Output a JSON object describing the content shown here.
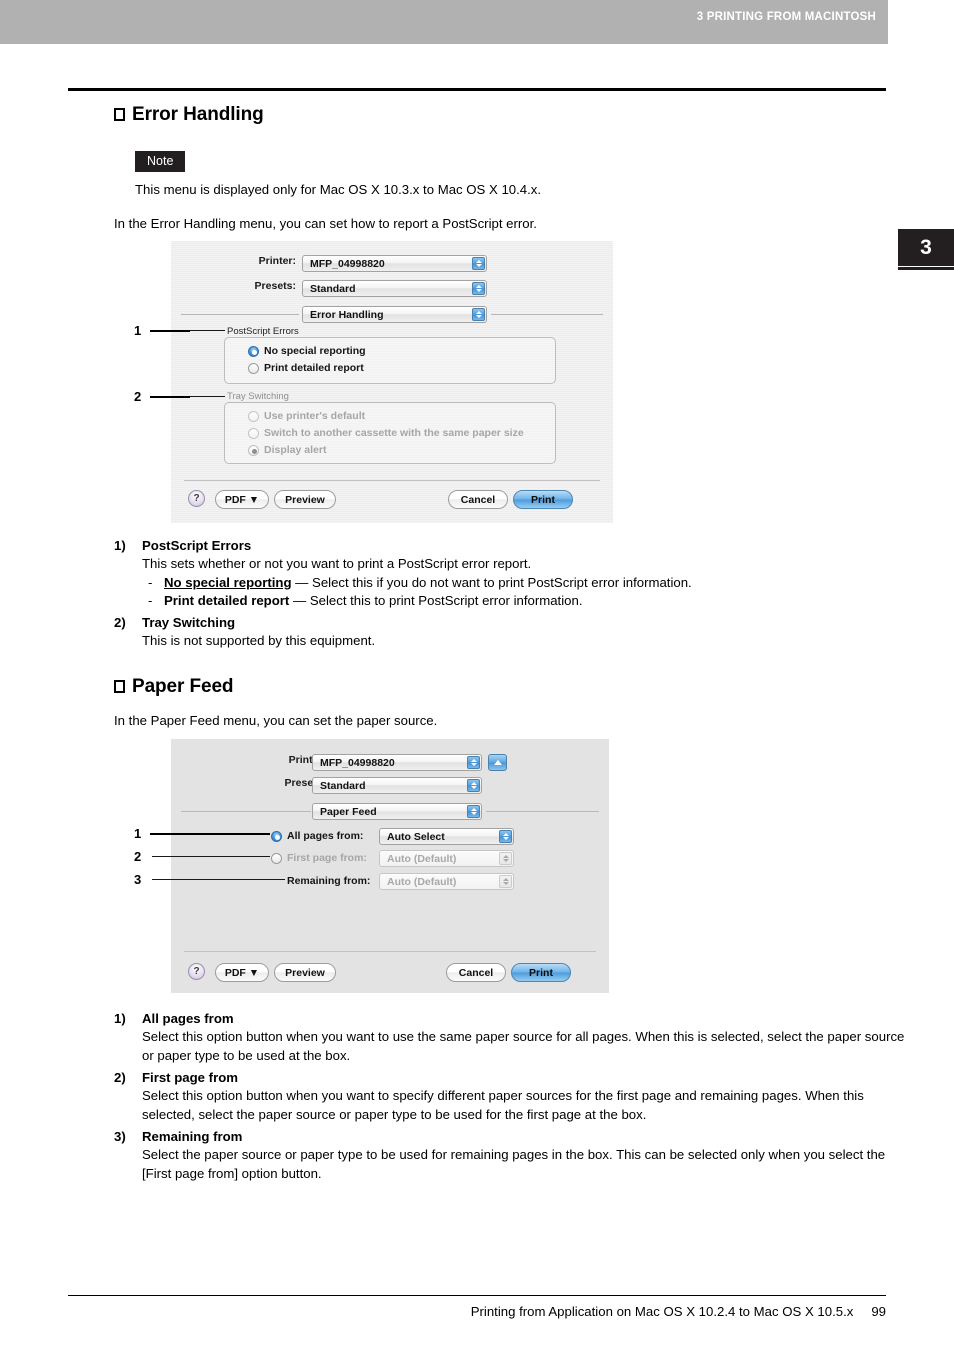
{
  "header": {
    "running_title": "3 PRINTING FROM MACINTOSH"
  },
  "chapter_tab": {
    "number": "3"
  },
  "sections": {
    "error_handling": {
      "heading": "Error Handling",
      "note_badge": "Note",
      "note_text": "This menu is displayed only for Mac OS X 10.3.x to Mac OS X 10.4.x.",
      "intro": "In the Error Handling menu, you can set how to report a PostScript error."
    },
    "paper_feed": {
      "heading": "Paper Feed",
      "intro": "In the Paper Feed menu, you can set the paper source."
    }
  },
  "dialog_error_handling": {
    "printer_label": "Printer:",
    "printer_value": "MFP_04998820",
    "presets_label": "Presets:",
    "presets_value": "Standard",
    "pane_value": "Error Handling",
    "group1_title": "PostScript Errors",
    "group1_options": [
      {
        "label": "No special reporting",
        "selected": true,
        "disabled": false
      },
      {
        "label": "Print detailed report",
        "selected": false,
        "disabled": false
      }
    ],
    "group2_title": "Tray Switching",
    "group2_options": [
      {
        "label": "Use printer's default",
        "selected": false,
        "disabled": true
      },
      {
        "label": "Switch to another cassette with the same paper size",
        "selected": false,
        "disabled": true
      },
      {
        "label": "Display alert",
        "selected": true,
        "disabled": true
      }
    ],
    "help_label": "?",
    "pdf_label": "PDF ▼",
    "preview_label": "Preview",
    "cancel_label": "Cancel",
    "print_label": "Print",
    "callouts": [
      "1",
      "2"
    ]
  },
  "dialog_paper_feed": {
    "printer_label": "Printer:",
    "printer_value": "MFP_04998820",
    "presets_label": "Presets:",
    "presets_value": "Standard",
    "pane_value": "Paper Feed",
    "rows": [
      {
        "label": "All pages from:",
        "value": "Auto Select",
        "radio": true,
        "selected": true,
        "disabled": false
      },
      {
        "label": "First page from:",
        "value": "Auto (Default)",
        "radio": true,
        "selected": false,
        "disabled": true
      },
      {
        "label": "Remaining from:",
        "value": "Auto (Default)",
        "radio": false,
        "selected": false,
        "disabled": true
      }
    ],
    "help_label": "?",
    "pdf_label": "PDF ▼",
    "preview_label": "Preview",
    "cancel_label": "Cancel",
    "print_label": "Print",
    "callouts": [
      "1",
      "2",
      "3"
    ]
  },
  "list_error_handling": [
    {
      "num": "1)",
      "title": "PostScript Errors",
      "body": "This sets whether or not you want to print a PostScript error report.",
      "sub": [
        {
          "dash": "-",
          "term": "No special reporting",
          "underline": true,
          "rest": " — Select this if you do not want to print PostScript error information."
        },
        {
          "dash": "-",
          "term": "Print detailed report",
          "underline": false,
          "rest": " — Select this to print PostScript error information."
        }
      ]
    },
    {
      "num": "2)",
      "title": "Tray Switching",
      "body": "This is not supported by this equipment.",
      "sub": []
    }
  ],
  "list_paper_feed": [
    {
      "num": "1)",
      "title": "All pages from",
      "body": "Select this option button when you want to use the same paper source for all pages.  When this is selected, select the paper source or paper type to be used at the box."
    },
    {
      "num": "2)",
      "title": "First page from",
      "body": "Select this option button when you want to specify different paper sources for the first page and remaining pages.  When this selected, select the paper source or paper type to be used for the first page at the box."
    },
    {
      "num": "3)",
      "title": "Remaining from",
      "body": "Select the paper source or paper type to be used for remaining pages in the box.  This can be selected only when you select the [First page from] option button."
    }
  ],
  "footer": {
    "text": "Printing from Application on Mac OS X 10.2.4 to Mac OS X 10.5.x",
    "page_number": "99"
  }
}
